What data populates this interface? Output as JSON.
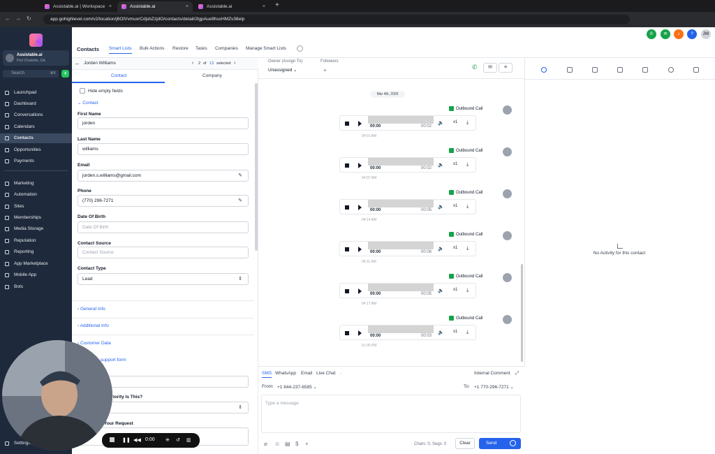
{
  "browser": {
    "tabs": [
      {
        "label": "Assistable.ai | Workspace",
        "active": false
      },
      {
        "label": "Assistable.ai",
        "active": true
      },
      {
        "label": "Assistable.ai",
        "active": false
      }
    ],
    "url": "app.gohighlevel.com/v2/location/j6OIVvmuxrCdjsbZzjdO/contacts/detail/2lgpAue9hsxHMZv38elp"
  },
  "sidebar": {
    "account_name": "Assistable.ai",
    "account_location": "Port Charlotte, GA",
    "search_placeholder": "Search",
    "search_shortcut": "⌘K",
    "items": [
      {
        "label": "Launchpad"
      },
      {
        "label": "Dashboard"
      },
      {
        "label": "Conversations"
      },
      {
        "label": "Calendars"
      },
      {
        "label": "Contacts",
        "active": true
      },
      {
        "label": "Opportunities"
      },
      {
        "label": "Payments"
      }
    ],
    "items2": [
      {
        "label": "Marketing"
      },
      {
        "label": "Automation"
      },
      {
        "label": "Sites"
      },
      {
        "label": "Memberships"
      },
      {
        "label": "Media Storage"
      },
      {
        "label": "Reputation"
      },
      {
        "label": "Reporting"
      },
      {
        "label": "App Marketplace"
      },
      {
        "label": "Mobile App"
      },
      {
        "label": "Bots"
      }
    ],
    "settings": "Settings"
  },
  "header": {
    "title": "Contacts",
    "tabs": [
      "Smart Lists",
      "Bulk Actions",
      "Restore",
      "Tasks",
      "Companies",
      "Manage Smart Lists"
    ],
    "avatar_initials": "JW"
  },
  "contact": {
    "name": "Jorden Williams",
    "pager_current": "2",
    "pager_of": "of",
    "pager_total": "13",
    "pager_selected": "selected",
    "subtabs": [
      "Contact",
      "Company"
    ],
    "hide_empty": "Hide empty fields",
    "section_contact": "Contact",
    "first_name_label": "First Name",
    "first_name": "jorden",
    "last_name_label": "Last Name",
    "last_name": "williams",
    "email_label": "Email",
    "email": "jorden.s.williams@gmail.com",
    "phone_label": "Phone",
    "phone": "(770) 296-7271",
    "dob_label": "Date Of Birth",
    "dob_placeholder": "Date Of Birth",
    "source_label": "Contact Source",
    "source_placeholder": "Contact Source",
    "type_label": "Contact Type",
    "type_value": "Lead",
    "sections": [
      "General Info",
      "Additional Info",
      "Customer Data"
    ],
    "support_form": "support form",
    "priority_label": "Priority Is This?",
    "request_label": "Your Request"
  },
  "conversation": {
    "owner_label": "Owner (Assign To)",
    "owner_value": "Unassigned",
    "followers_label": "Followers",
    "date": "Mar 4th, 2025",
    "calls": [
      {
        "label": "Outbound Call",
        "start": "00:00",
        "duration": "00:02",
        "speed": "x1",
        "time": "04:01 AM"
      },
      {
        "label": "Outbound Call",
        "start": "00:00",
        "duration": "00:02",
        "speed": "x1",
        "time": "04:07 AM"
      },
      {
        "label": "Outbound Call",
        "start": "00:00",
        "duration": "00:05",
        "speed": "x1",
        "time": "04:14 AM"
      },
      {
        "label": "Outbound Call",
        "start": "00:00",
        "duration": "00:08",
        "speed": "x1",
        "time": "04:11 AM"
      },
      {
        "label": "Outbound Call",
        "start": "00:00",
        "duration": "00:05",
        "speed": "x1",
        "time": "04:17 AM"
      },
      {
        "label": "Outbound Call",
        "start": "00:00",
        "duration": "00:03",
        "speed": "x1",
        "time": "01:00 PM"
      }
    ]
  },
  "composer": {
    "tabs": [
      "SMS",
      "WhatsApp",
      "Email",
      "Live Chat"
    ],
    "more": "·",
    "internal_comment": "Internal Comment",
    "from_label": "From:",
    "from_value": "+1 844-237-6585",
    "to_label": "To:",
    "to_value": "+1 770-296-7271",
    "placeholder": "Type a message",
    "chars": "Chars: 0, Segs: 0",
    "clear": "Clear",
    "send": "Send"
  },
  "activity": {
    "empty": "No Activity for this contact"
  },
  "recorder": {
    "time": "0:00"
  }
}
